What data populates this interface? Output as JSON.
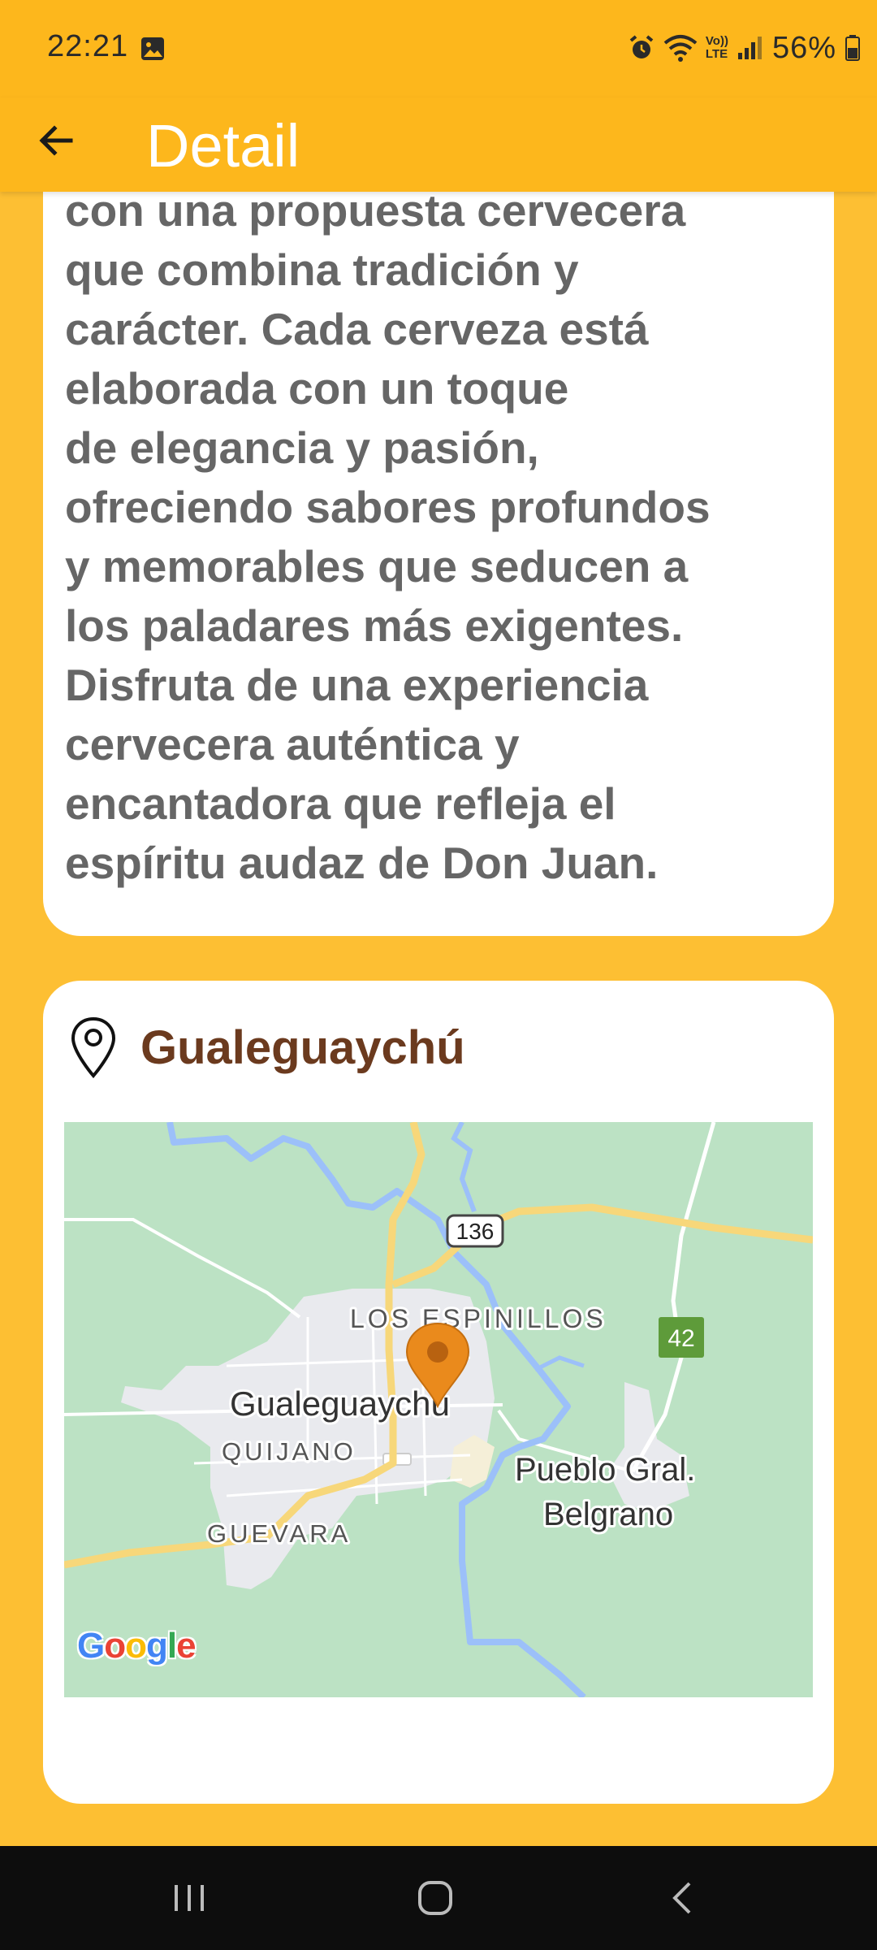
{
  "status_bar": {
    "time": "22:21",
    "battery": "56%",
    "icons": [
      "image-icon",
      "alarm-icon",
      "wifi-icon",
      "volte-icon",
      "signal-icon",
      "battery-icon"
    ],
    "volte_top": "Vo))",
    "volte_bottom": "LTE"
  },
  "app_bar": {
    "title": "Detail",
    "back_icon": "arrow-left-icon"
  },
  "description": {
    "text": "Descubre la magia de Don Juan\ncon una propuesta cervecera\nque combina tradición y\ncarácter. Cada cerveza está\nelaborada con un toque\nde elegancia y pasión,\nofreciendo sabores profundos\ny memorables que seducen a\nlos paladares más exigentes.\nDisfruta de una experiencia\ncervecera auténtica y\nencantadora que refleja el\nespíritu audaz de Don Juan."
  },
  "location": {
    "city": "Gualeguaychú",
    "pin_icon": "location-pin-icon",
    "map": {
      "labels": {
        "route_136": "136",
        "route_42": "42",
        "los_espinillos": "LOS ESPINILLOS",
        "city": "Gualeguaychú",
        "quijano": "QUIJANO",
        "guevara": "GUEVARA",
        "pueblo_line1": "Pueblo Gral.",
        "pueblo_line2": "Belgrano"
      },
      "logo_text": "Google",
      "colors": {
        "land": "#BCE2C4",
        "urban": "#E9EAEE",
        "water": "#9CC0F9",
        "highway": "#F7D77A",
        "marker": "#EA8A1C"
      }
    }
  },
  "nav_bar": {
    "icons": [
      "recents-icon",
      "home-icon",
      "back-icon"
    ]
  },
  "colors": {
    "background": "#FDBF33",
    "app_bar": "#FDB71C",
    "title_brown": "#6B3A1E",
    "body_text": "#666666"
  }
}
